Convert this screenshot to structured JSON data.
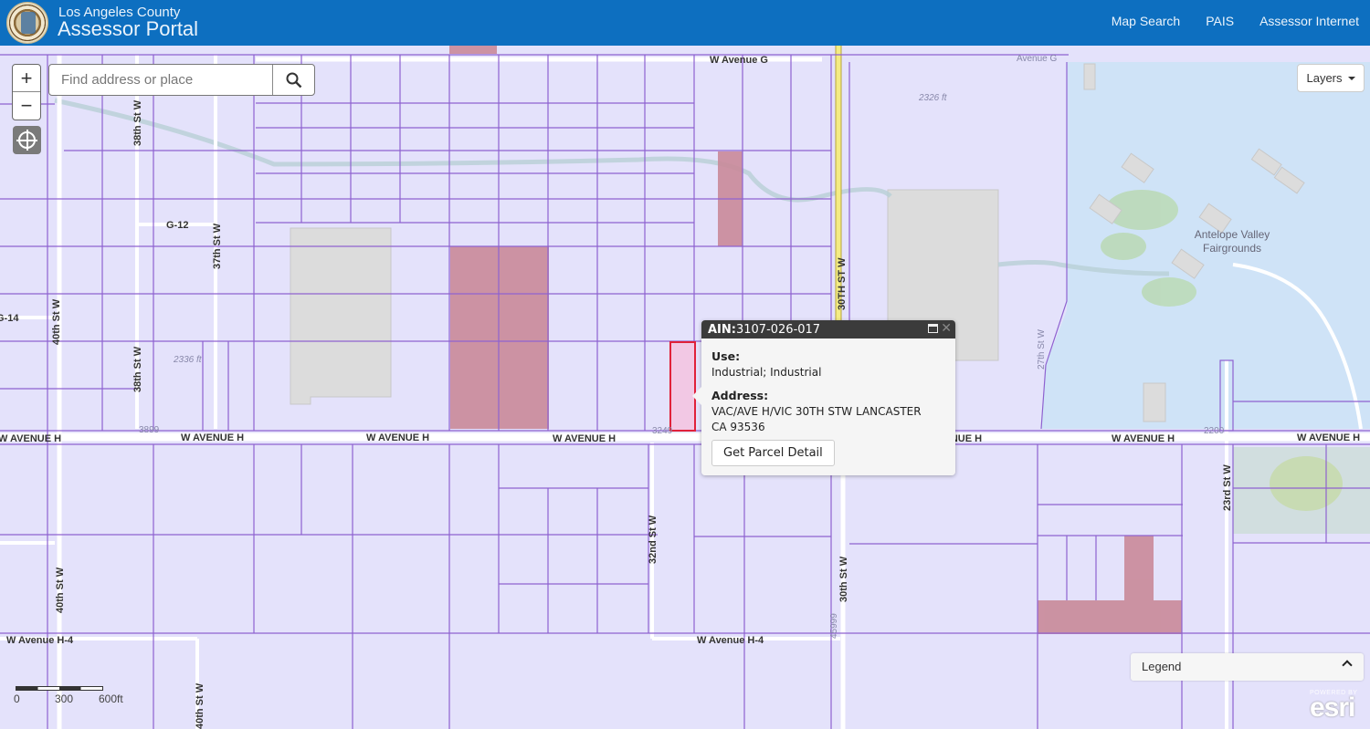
{
  "header": {
    "org": "Los Angeles County",
    "title": "Assessor Portal",
    "nav": [
      {
        "label": "Map Search"
      },
      {
        "label": "PAIS"
      },
      {
        "label": "Assessor Internet"
      }
    ]
  },
  "map_controls": {
    "zoom_in": "+",
    "zoom_out": "−",
    "search_placeholder": "Find address or place",
    "search_value": "",
    "layers_label": "Layers",
    "legend_label": "Legend"
  },
  "popup": {
    "ain_label": "AIN:",
    "ain_value": "3107-026-017",
    "use_label": "Use:",
    "use_value": "Industrial; Industrial",
    "address_label": "Address:",
    "address_line1": "VAC/AVE H/VIC 30TH STW LANCASTER",
    "address_line2": "CA 93536",
    "button_label": "Get Parcel Detail"
  },
  "scalebar": {
    "labels": [
      "0",
      "300",
      "600ft"
    ]
  },
  "attribution": {
    "powered_by": "POWERED BY",
    "brand": "esri"
  },
  "map_labels": {
    "roads": {
      "w_avenue_g": "W Avenue G",
      "avenue_g_faint": "Avenue G",
      "w_avenue_h": "W AVENUE H",
      "w_avenue_h4": "W Avenue H-4",
      "st_30th_upper": "30TH ST W",
      "st_30th_lower": "30th St W",
      "st_32nd": "32nd St W",
      "st_37th": "37th St W",
      "st_38th": "38th St W",
      "st_40th": "40th St W",
      "st_23rd": "23rd St W",
      "st_27th": "27th St W",
      "g12": "G-12",
      "g14": "G-14"
    },
    "address_numbers": [
      "3899",
      "3249",
      "2200",
      "45999"
    ],
    "elevation": [
      "2326 ft",
      "2336 ft"
    ],
    "places": {
      "fairgrounds_line1": "Antelope Valley",
      "fairgrounds_line2": "Fairgrounds"
    }
  },
  "colors": {
    "header_bg": "#0d6fc0",
    "parcel_fill": "#e4e2fb",
    "parcel_line": "#8e62d0",
    "industrial_fill": "#c98a99",
    "selected_outline": "#e0213a",
    "water_fill": "#cfe3f7",
    "road_highway": "#f4ec84"
  }
}
